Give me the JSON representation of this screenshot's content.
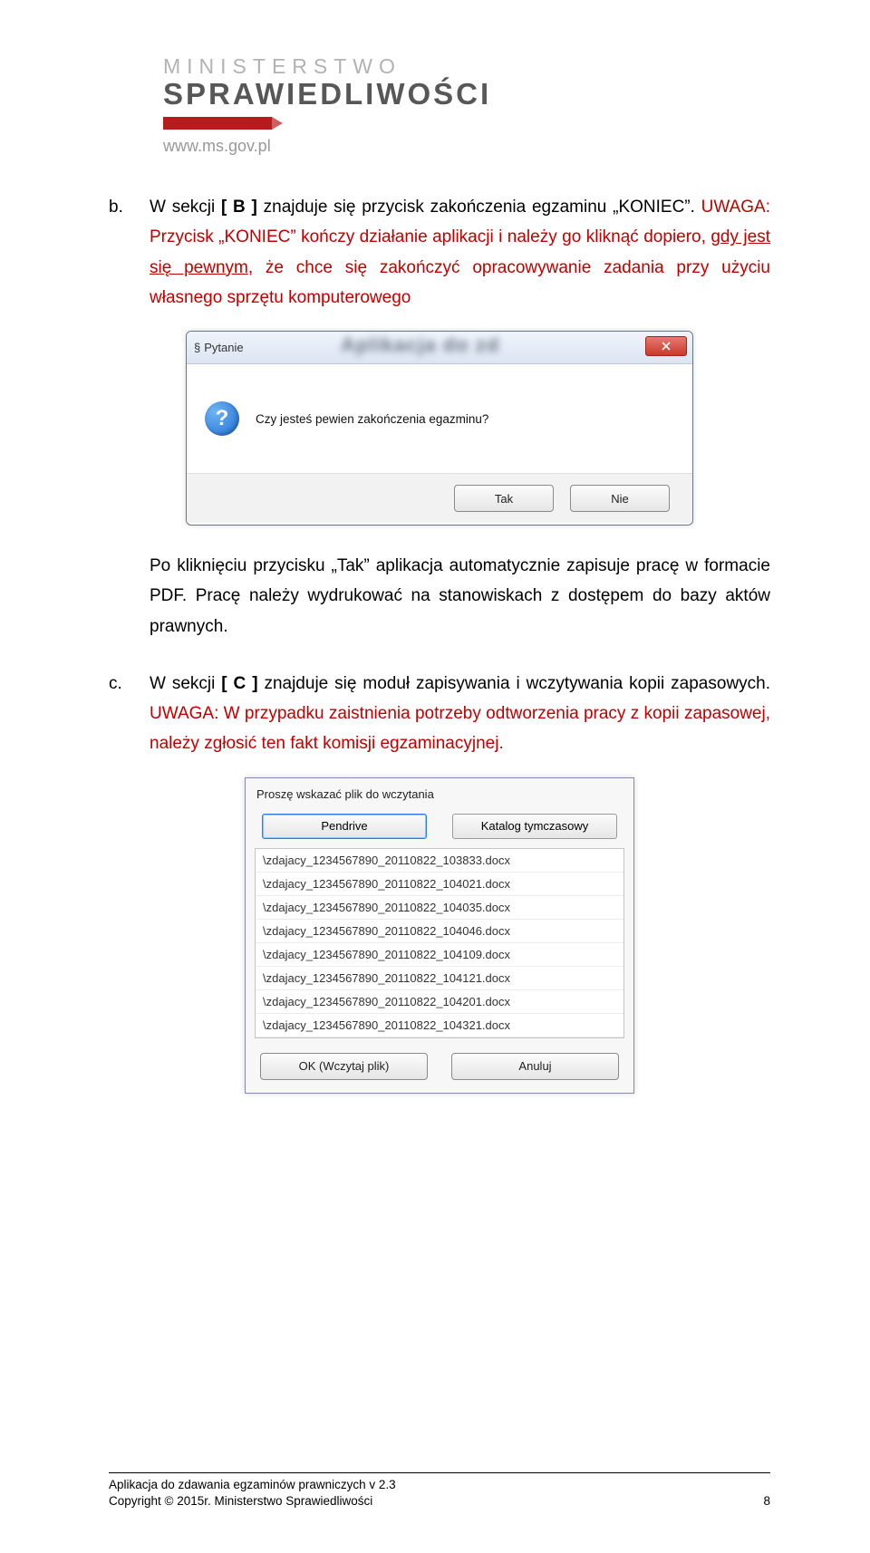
{
  "header": {
    "ministry_line1": "MINISTERSTWO",
    "ministry_line2": "SPRAWIEDLIWOŚCI",
    "url": "www.ms.gov.pl"
  },
  "para_b": {
    "marker": "b.",
    "sentence1_pre": "W sekcji ",
    "sentence1_b": "[ B ]",
    "sentence1_post": " znajduje się przycisk zakończenia egzaminu „KONIEC”. ",
    "warn1": "UWAGA: Przycisk „KONIEC” kończy działanie aplikacji i należy go kliknąć dopiero, ",
    "warn_underlined": "gdy jest się pewnym",
    "warn2": ", że chce się zakończyć opracowywanie zadania przy użyciu własnego sprzętu komputerowego"
  },
  "dialog1": {
    "title": "Pytanie",
    "blur_title": "Aplikacja do zd",
    "question": "Czy jesteś pewien zakończenia egazminu?",
    "yes": "Tak",
    "no": "Nie"
  },
  "para_after_dialog": "Po kliknięciu przycisku „Tak” aplikacja automatycznie zapisuje pracę w formacie PDF. Pracę należy wydrukować na stanowiskach z dostępem do bazy aktów prawnych.",
  "para_c": {
    "marker": "c.",
    "pre": "W sekcji ",
    "b": "[ C ]",
    "post": " znajduje się moduł zapisywania i wczytywania kopii zapasowych. ",
    "warn": "UWAGA: W przypadku zaistnienia potrzeby odtworzenia pracy z kopii zapasowej, należy zgłosić ten fakt komisji egzaminacyjnej."
  },
  "dialog2": {
    "prompt": "Proszę wskazać plik do wczytania",
    "tab1": "Pendrive",
    "tab2": "Katalog tymczasowy",
    "files": [
      "\\zdajacy_1234567890_20110822_103833.docx",
      "\\zdajacy_1234567890_20110822_104021.docx",
      "\\zdajacy_1234567890_20110822_104035.docx",
      "\\zdajacy_1234567890_20110822_104046.docx",
      "\\zdajacy_1234567890_20110822_104109.docx",
      "\\zdajacy_1234567890_20110822_104121.docx",
      "\\zdajacy_1234567890_20110822_104201.docx",
      "\\zdajacy_1234567890_20110822_104321.docx"
    ],
    "ok": "OK (Wczytaj plik)",
    "cancel": "Anuluj"
  },
  "footer": {
    "line1": "Aplikacja do zdawania egzaminów prawniczych v 2.3",
    "line2": "Copyright © 2015r. Ministerstwo Sprawiedliwości",
    "page": "8"
  }
}
